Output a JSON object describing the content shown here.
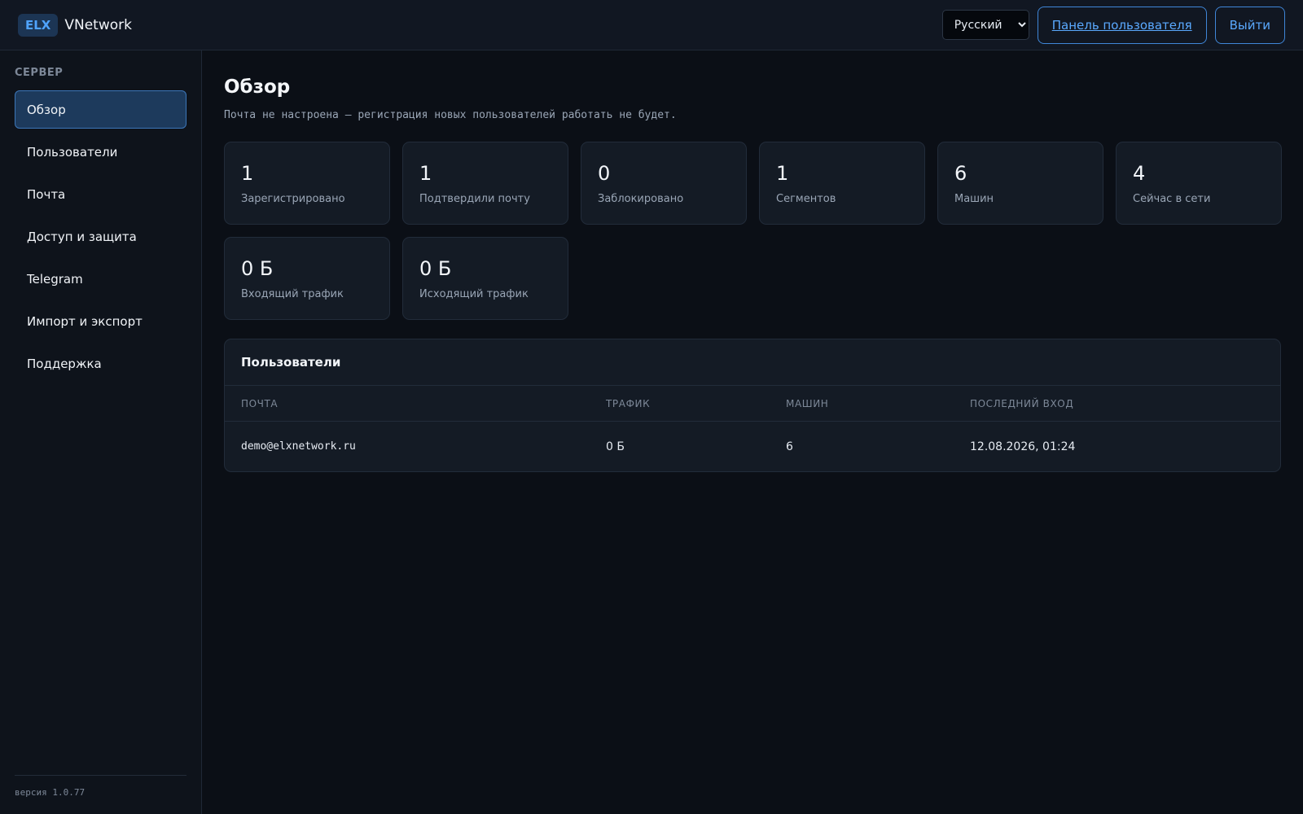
{
  "brand": {
    "badge": "ELX",
    "name": "VNetwork"
  },
  "header": {
    "language": "Русский",
    "language_options": [
      "Русский"
    ],
    "user_panel_label": "Панель пользователя",
    "logout_label": "Выйти"
  },
  "sidebar": {
    "section": "СЕРВЕР",
    "items": [
      {
        "label": "Обзор",
        "active": true
      },
      {
        "label": "Пользователи"
      },
      {
        "label": "Почта"
      },
      {
        "label": "Доступ и защита"
      },
      {
        "label": "Telegram"
      },
      {
        "label": "Импорт и экспорт"
      },
      {
        "label": "Поддержка"
      }
    ],
    "version": "версия 1.0.77"
  },
  "main": {
    "title": "Обзор",
    "notice": "Почта не настроена — регистрация новых пользователей работать не будет.",
    "stats": [
      {
        "value": "1",
        "label": "Зарегистрировано"
      },
      {
        "value": "1",
        "label": "Подтвердили почту"
      },
      {
        "value": "0",
        "label": "Заблокировано"
      },
      {
        "value": "1",
        "label": "Сегментов"
      },
      {
        "value": "6",
        "label": "Машин"
      },
      {
        "value": "4",
        "label": "Сейчас в сети"
      },
      {
        "value": "0 Б",
        "label": "Входящий трафик"
      },
      {
        "value": "0 Б",
        "label": "Исходящий трафик"
      }
    ],
    "users": {
      "title": "Пользователи",
      "columns": [
        "ПОЧТА",
        "ТРАФИК",
        "МАШИН",
        "ПОСЛЕДНИЙ ВХОД"
      ],
      "rows": [
        {
          "email": "demo@elxnetwork.ru",
          "traffic": "0 Б",
          "machines": "6",
          "last_login": "12.08.2026, 01:24"
        }
      ]
    }
  }
}
